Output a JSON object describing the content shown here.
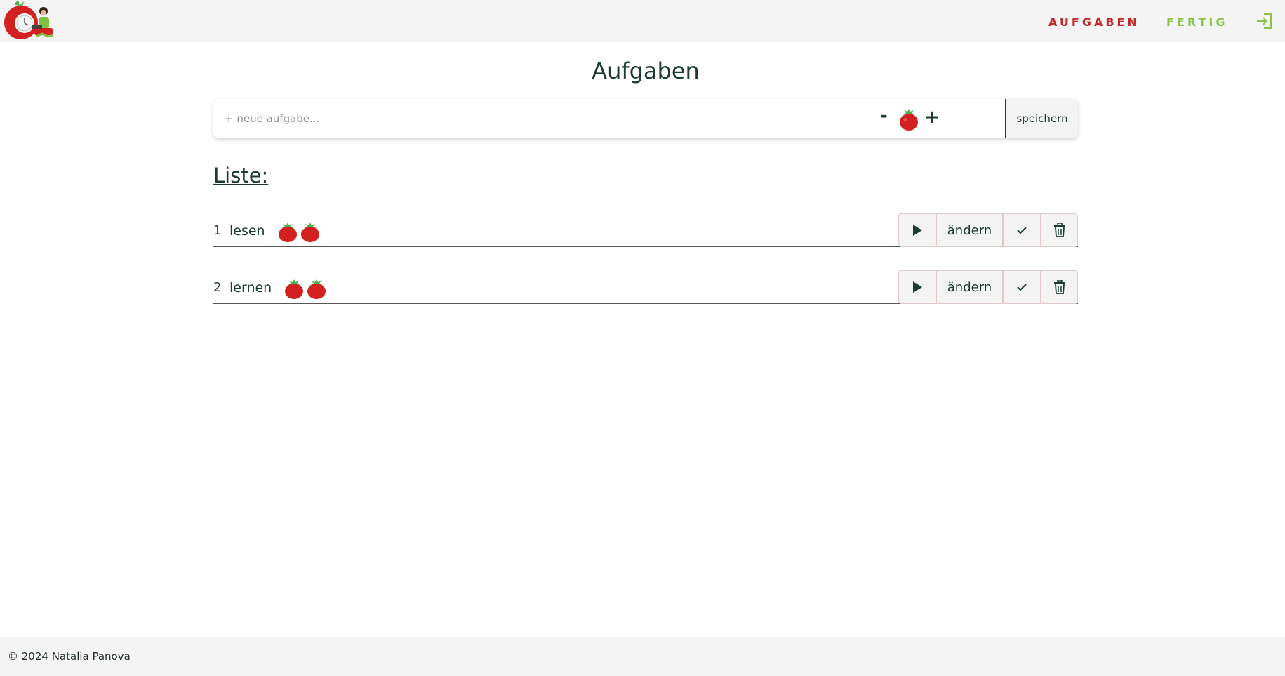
{
  "header": {
    "logo_icon": "tomato-clock-person-logo",
    "nav": [
      {
        "label": "AUFGABEN",
        "color": "#c62828"
      },
      {
        "label": "FERTIG",
        "color": "#8bc34a"
      }
    ],
    "login_icon": "sign-in-icon",
    "login_color": "#8bc34a"
  },
  "page": {
    "title": "Aufgaben"
  },
  "task_form": {
    "placeholder": "+ neue aufgabe...",
    "value": "",
    "minus_label": "-",
    "plus_label": "+",
    "pomodoro_count": 1,
    "save_label": "speichern"
  },
  "list": {
    "title": "Liste:",
    "tasks": [
      {
        "number": "1",
        "name": "lesen",
        "pomodoros": 2,
        "edit_label": "ändern"
      },
      {
        "number": "2",
        "name": "lernen",
        "pomodoros": 2,
        "edit_label": "ändern"
      }
    ]
  },
  "footer": {
    "text": "© 2024 Natalia Panova"
  },
  "colors": {
    "text": "#1d3b35",
    "tomato": "#d32020",
    "leaf": "#4caf50",
    "header_bg": "#f4f4f4"
  }
}
